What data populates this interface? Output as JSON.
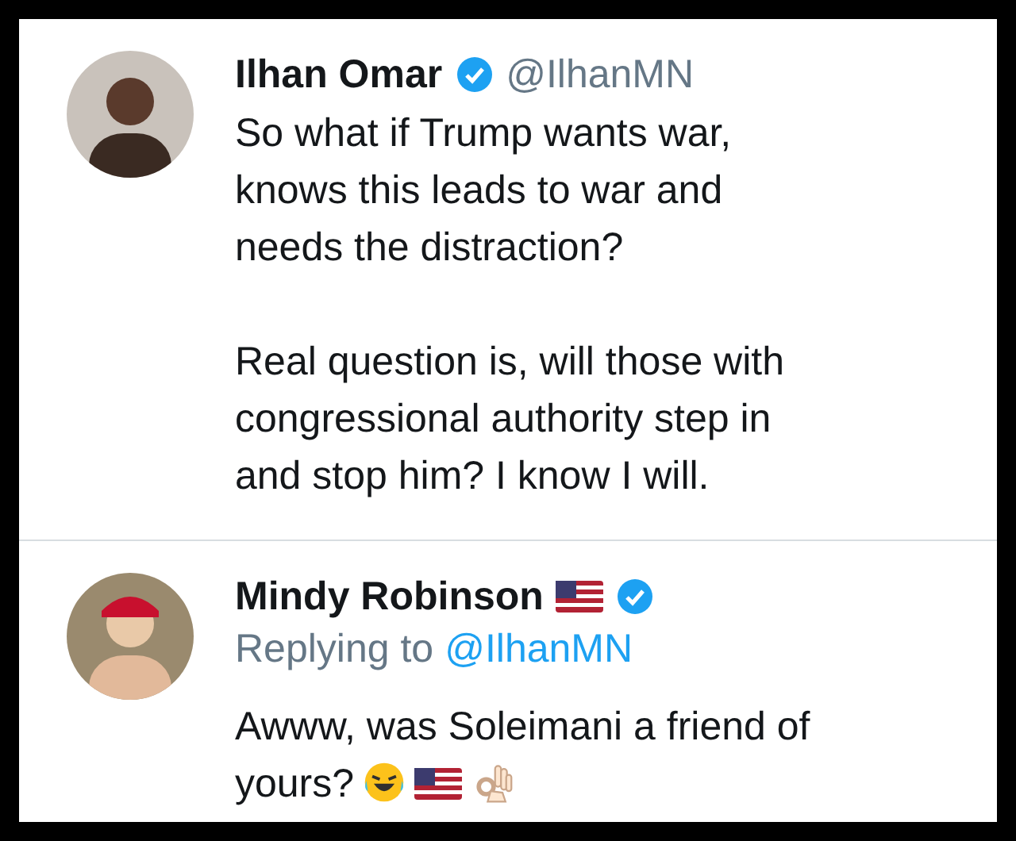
{
  "tweets": [
    {
      "name": "Ilhan Omar",
      "verified": true,
      "handle": "@IlhanMN",
      "paragraphs": [
        "So what if Trump wants war,\nknows this leads to war and\nneeds the distraction?",
        "Real question is, will those with\ncongressional authority step in\nand stop him? I know I will."
      ]
    },
    {
      "name": "Mindy Robinson",
      "flag": true,
      "verified": true,
      "replying_label": "Replying to",
      "replying_to": "@IlhanMN",
      "paragraphs": [
        "Awww, was Soleimani a friend of\nyours?"
      ],
      "trailing_emoji": true
    }
  ]
}
